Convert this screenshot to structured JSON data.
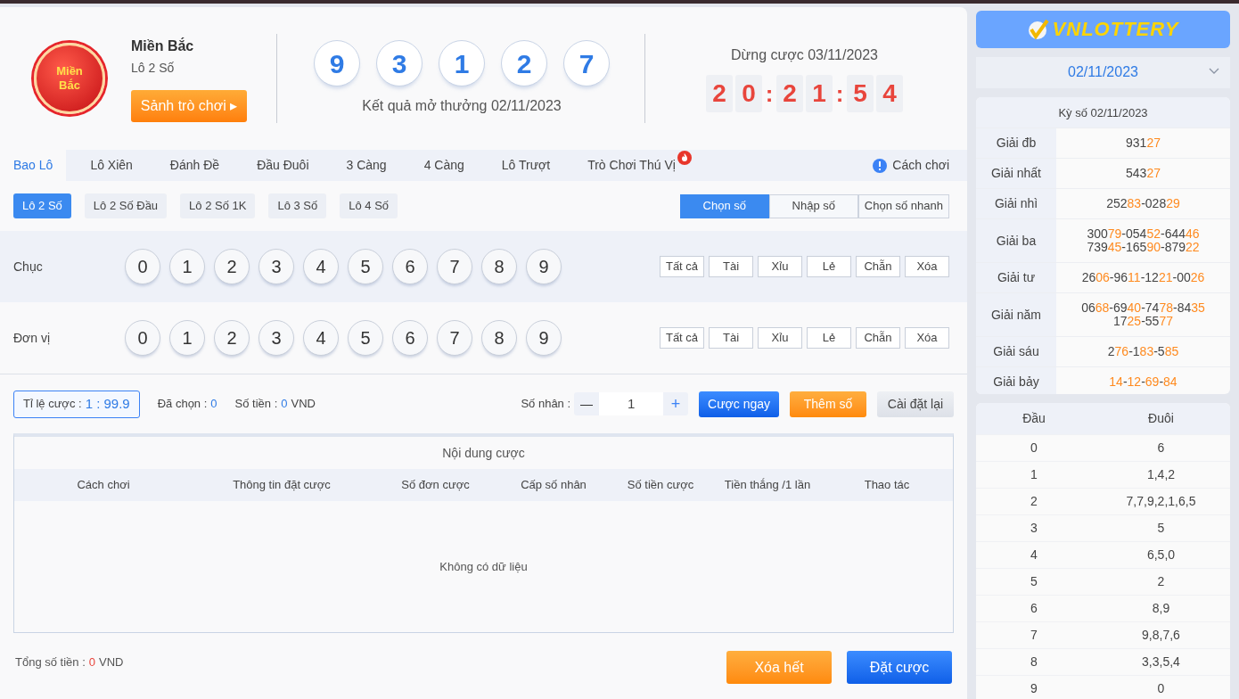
{
  "header": {
    "logo_text": [
      "Miền",
      "Bắc"
    ],
    "region": "Miền Bắc",
    "game": "Lô 2 Số",
    "lobby_button": "Sảnh trò chơi ▸",
    "result_balls": [
      "9",
      "3",
      "1",
      "2",
      "7"
    ],
    "result_caption": "Kết quả mở thưởng 02/11/2023",
    "stop_label": "Dừng cược 03/11/2023",
    "countdown": [
      {
        "text": "2",
        "kind": "digit"
      },
      {
        "text": "0",
        "kind": "digit"
      },
      {
        "text": ":",
        "kind": "colon"
      },
      {
        "text": "2",
        "kind": "digit"
      },
      {
        "text": "1",
        "kind": "digit"
      },
      {
        "text": ":",
        "kind": "colon"
      },
      {
        "text": "5",
        "kind": "digit"
      },
      {
        "text": "4",
        "kind": "digit"
      }
    ]
  },
  "tabs": [
    {
      "label": "Bao Lô",
      "selected": true,
      "hot": false
    },
    {
      "label": "Lô Xiên",
      "selected": false,
      "hot": false
    },
    {
      "label": "Đánh Đề",
      "selected": false,
      "hot": false
    },
    {
      "label": "Đầu Đuôi",
      "selected": false,
      "hot": false
    },
    {
      "label": "3 Càng",
      "selected": false,
      "hot": false
    },
    {
      "label": "4 Càng",
      "selected": false,
      "hot": false
    },
    {
      "label": "Lô Trượt",
      "selected": false,
      "hot": false
    },
    {
      "label": "Trò Chơi Thú Vị",
      "selected": false,
      "hot": true
    }
  ],
  "help_link": "Cách chơi",
  "sub_tabs": [
    {
      "label": "Lô 2 Số",
      "selected": true
    },
    {
      "label": "Lô 2 Số Đầu",
      "selected": false
    },
    {
      "label": "Lô 2 Số 1K",
      "selected": false
    },
    {
      "label": "Lô 3 Số",
      "selected": false
    },
    {
      "label": "Lô 4 Số",
      "selected": false
    }
  ],
  "modes": [
    {
      "label": "Chọn số",
      "selected": true
    },
    {
      "label": "Nhập số",
      "selected": false
    },
    {
      "label": "Chọn số nhanh",
      "selected": false
    }
  ],
  "picker_rows": [
    {
      "label": "Chục",
      "digits": [
        {
          "label": "0",
          "selected": false
        },
        {
          "label": "1",
          "selected": false
        },
        {
          "label": "2",
          "selected": false
        },
        {
          "label": "3",
          "selected": false
        },
        {
          "label": "4",
          "selected": false
        },
        {
          "label": "5",
          "selected": false
        },
        {
          "label": "6",
          "selected": false
        },
        {
          "label": "7",
          "selected": false
        },
        {
          "label": "8",
          "selected": false
        },
        {
          "label": "9",
          "selected": false
        }
      ],
      "quick": [
        "Tất cả",
        "Tài",
        "Xỉu",
        "Lẻ",
        "Chẵn",
        "Xóa"
      ]
    },
    {
      "label": "Đơn vị",
      "digits": [
        {
          "label": "0",
          "selected": false
        },
        {
          "label": "1",
          "selected": false
        },
        {
          "label": "2",
          "selected": false
        },
        {
          "label": "3",
          "selected": false
        },
        {
          "label": "4",
          "selected": false
        },
        {
          "label": "5",
          "selected": false
        },
        {
          "label": "6",
          "selected": false
        },
        {
          "label": "7",
          "selected": false
        },
        {
          "label": "8",
          "selected": false
        },
        {
          "label": "9",
          "selected": false
        }
      ],
      "quick": [
        "Tất cả",
        "Tài",
        "Xỉu",
        "Lẻ",
        "Chẵn",
        "Xóa"
      ]
    }
  ],
  "bet_bar": {
    "odds_label": "Tỉ lệ cược :",
    "odds": "1 : 99.9",
    "chosen_label": "Đã chọn :",
    "chosen": "0",
    "amount_label": "Số tiền :",
    "amount": "0",
    "currency": "VND",
    "multiplier_label": "Số nhân :",
    "minus": "—",
    "multiplier": "1",
    "plus": "+",
    "buttons": [
      {
        "label": "Cược ngay",
        "kind": "primary"
      },
      {
        "label": "Thêm số",
        "kind": "accent"
      },
      {
        "label": "Cài đặt lại",
        "kind": "plain"
      }
    ]
  },
  "bet_table": {
    "title": "Nội dung cược",
    "columns": [
      "Cách chơi",
      "Thông tin đặt cược",
      "Số đơn cược",
      "Cấp số nhân",
      "Số tiền cược",
      "Tiền thắng /1 lần",
      "Thao tác"
    ],
    "empty": "Không có dữ liệu"
  },
  "footer": {
    "total_label": "Tổng số tiền :",
    "total": "0",
    "currency": "VND",
    "buttons": [
      {
        "label": "Xóa hết",
        "kind": "accent"
      },
      {
        "label": "Đặt cược",
        "kind": "primary"
      }
    ]
  },
  "sidebar": {
    "brand": "VNLOTTERY",
    "date": "02/11/2023",
    "results": {
      "title": "Kỳ số 02/11/2023",
      "sep": "-",
      "rows": [
        {
          "prize": "Giải đb",
          "lines": [
            [
              {
                "head": "931",
                "tail": "27"
              }
            ]
          ]
        },
        {
          "prize": "Giải nhất",
          "lines": [
            [
              {
                "head": "543",
                "tail": "27"
              }
            ]
          ]
        },
        {
          "prize": "Giải nhì",
          "lines": [
            [
              {
                "head": "252",
                "tail": "83"
              },
              {
                "head": "028",
                "tail": "29"
              }
            ]
          ]
        },
        {
          "prize": "Giải ba",
          "lines": [
            [
              {
                "head": "300",
                "tail": "79"
              },
              {
                "head": "054",
                "tail": "52"
              },
              {
                "head": "644",
                "tail": "46"
              }
            ],
            [
              {
                "head": "739",
                "tail": "45"
              },
              {
                "head": "165",
                "tail": "90"
              },
              {
                "head": "879",
                "tail": "22"
              }
            ]
          ]
        },
        {
          "prize": "Giải tư",
          "lines": [
            [
              {
                "head": "26",
                "tail": "06"
              },
              {
                "head": "96",
                "tail": "11"
              },
              {
                "head": "12",
                "tail": "21"
              },
              {
                "head": "00",
                "tail": "26"
              }
            ]
          ]
        },
        {
          "prize": "Giải năm",
          "lines": [
            [
              {
                "head": "06",
                "tail": "68"
              },
              {
                "head": "69",
                "tail": "40"
              },
              {
                "head": "74",
                "tail": "78"
              },
              {
                "head": "84",
                "tail": "35"
              }
            ],
            [
              {
                "head": "17",
                "tail": "25"
              },
              {
                "head": "55",
                "tail": "77"
              }
            ]
          ]
        },
        {
          "prize": "Giải sáu",
          "lines": [
            [
              {
                "head": "2",
                "tail": "76"
              },
              {
                "head": "1",
                "tail": "83"
              },
              {
                "head": "5",
                "tail": "85"
              }
            ]
          ]
        },
        {
          "prize": "Giải bảy",
          "lines": [
            [
              {
                "tail": "14"
              },
              {
                "tail": "12"
              },
              {
                "tail": "69"
              },
              {
                "tail": "84"
              }
            ]
          ]
        }
      ]
    },
    "head_tail": {
      "columns": [
        "Đầu",
        "Đuôi"
      ],
      "rows": [
        {
          "head": "0",
          "tail": "6"
        },
        {
          "head": "1",
          "tail": "1,4,2"
        },
        {
          "head": "2",
          "tail": "7,7,9,2,1,6,5"
        },
        {
          "head": "3",
          "tail": "5"
        },
        {
          "head": "4",
          "tail": "6,5,0"
        },
        {
          "head": "5",
          "tail": "2"
        },
        {
          "head": "6",
          "tail": "8,9"
        },
        {
          "head": "7",
          "tail": "9,8,7,6"
        },
        {
          "head": "8",
          "tail": "3,3,5,4"
        },
        {
          "head": "9",
          "tail": "0"
        }
      ]
    }
  }
}
